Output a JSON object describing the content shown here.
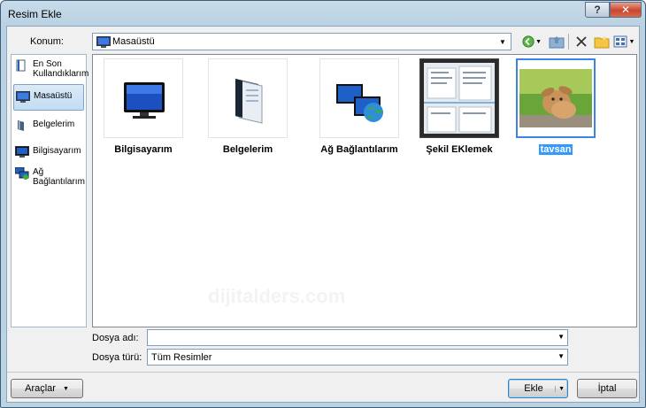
{
  "window": {
    "title": "Resim Ekle",
    "help": "?",
    "close": "✕"
  },
  "location": {
    "label": "Konum:",
    "value": "Masaüstü"
  },
  "places": [
    {
      "label": "En Son Kullandıklarım",
      "icon": "recent-icon"
    },
    {
      "label": "Masaüstü",
      "icon": "desktop-icon"
    },
    {
      "label": "Belgelerim",
      "icon": "documents-icon"
    },
    {
      "label": "Bilgisayarım",
      "icon": "computer-icon"
    },
    {
      "label": "Ağ Bağlantılarım",
      "icon": "network-icon"
    }
  ],
  "files": [
    {
      "name": "Bilgisayarım",
      "icon": "monitor-icon"
    },
    {
      "name": "Belgelerim",
      "icon": "folder-documents-icon"
    },
    {
      "name": "Ağ Bağlantılarım",
      "icon": "network-places-icon"
    },
    {
      "name": "Şekil EKlemek",
      "icon": "screenshot-thumbnail"
    },
    {
      "name": "tavsan",
      "icon": "rabbit-photo-thumbnail",
      "selected": true
    }
  ],
  "watermark": "dijitalders.com",
  "filename": {
    "label": "Dosya adı:",
    "value": ""
  },
  "filetype": {
    "label": "Dosya türü:",
    "value": "Tüm Resimler"
  },
  "buttons": {
    "tools": "Araçlar",
    "insert": "Ekle",
    "cancel": "İptal"
  },
  "colors": {
    "selection": "#3399ff",
    "titlebar": "#bcd3e4",
    "close": "#c8452c"
  }
}
